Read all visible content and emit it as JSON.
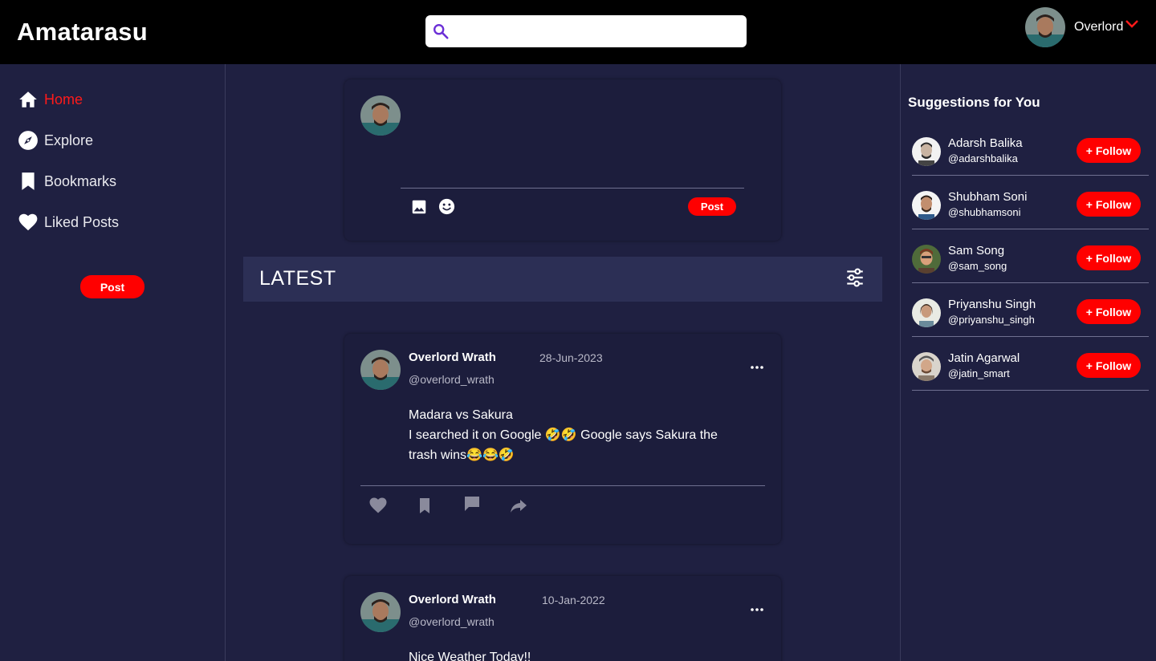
{
  "app": {
    "title": "Amatarasu"
  },
  "search": {
    "placeholder": "",
    "value": ""
  },
  "user": {
    "display_name": "Overlord"
  },
  "nav": {
    "items": [
      {
        "label": "Home",
        "icon": "home-icon",
        "active": true
      },
      {
        "label": "Explore",
        "icon": "compass-icon",
        "active": false
      },
      {
        "label": "Bookmarks",
        "icon": "bookmark-icon",
        "active": false
      },
      {
        "label": "Liked Posts",
        "icon": "heart-icon",
        "active": false
      }
    ],
    "post_button": "Post"
  },
  "composer": {
    "placeholder": "",
    "post_button": "Post"
  },
  "feed": {
    "section_title": "LATEST",
    "posts": [
      {
        "author": "Overlord Wrath",
        "handle": "@overlord_wrath",
        "date": "28-Jun-2023",
        "lines": [
          "Madara vs Sakura",
          "I searched it on Google 🤣🤣 Google says Sakura the trash wins😂😂🤣"
        ]
      },
      {
        "author": "Overlord Wrath",
        "handle": "@overlord_wrath",
        "date": "10-Jan-2022",
        "lines": [
          "Nice Weather Today!!"
        ]
      }
    ]
  },
  "suggestions": {
    "title": "Suggestions for You",
    "follow_label": "+ Follow",
    "users": [
      {
        "name": "Adarsh Balika",
        "handle": "@adarshbalika"
      },
      {
        "name": "Shubham Soni",
        "handle": "@shubhamsoni"
      },
      {
        "name": "Sam Song",
        "handle": "@sam_song"
      },
      {
        "name": "Priyanshu Singh",
        "handle": "@priyanshu_singh"
      },
      {
        "name": "Jatin Agarwal",
        "handle": "@jatin_smart"
      }
    ]
  },
  "colors": {
    "background": "#1f2041",
    "header": "#000000",
    "card": "#1c1d3c",
    "accent_red": "#ff0000",
    "latest_bar": "#2c2f55",
    "search_icon": "#6b2fd6"
  }
}
